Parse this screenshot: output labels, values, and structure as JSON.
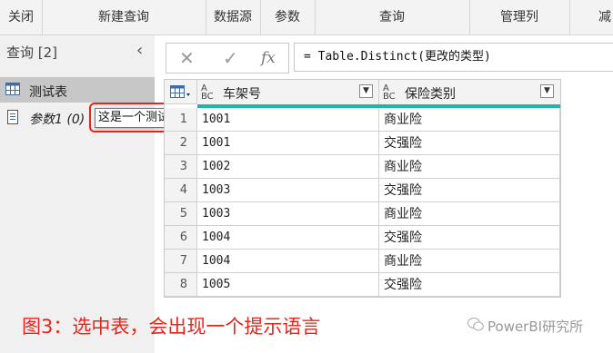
{
  "ribbon": {
    "groups": [
      "关闭",
      "新建查询",
      "数据源",
      "参数",
      "查询",
      "管理列",
      "减"
    ]
  },
  "query_pane": {
    "header": "查询 [2]",
    "collapse_glyph": "‹",
    "items": [
      {
        "label": "测试表",
        "icon": "table-icon",
        "selected": true
      },
      {
        "label": "参数1 (0)",
        "icon": "parameter-icon",
        "selected": false
      }
    ],
    "tooltip": "这是一个测试"
  },
  "formula_bar": {
    "cancel_glyph": "✕",
    "commit_glyph": "✓",
    "fx_glyph": "fx",
    "formula": "= Table.Distinct(更改的类型)"
  },
  "table": {
    "columns": [
      {
        "type_icon": "text-type-icon",
        "type_glyph_top": "A",
        "type_glyph_bottom": "BC",
        "name": "车架号"
      },
      {
        "type_icon": "text-type-icon",
        "type_glyph_top": "A",
        "type_glyph_bottom": "BC",
        "name": "保险类别"
      }
    ],
    "rows": [
      {
        "n": "1",
        "vin": "1001",
        "category": "商业险"
      },
      {
        "n": "2",
        "vin": "1001",
        "category": "交强险"
      },
      {
        "n": "3",
        "vin": "1002",
        "category": "商业险"
      },
      {
        "n": "4",
        "vin": "1003",
        "category": "交强险"
      },
      {
        "n": "5",
        "vin": "1003",
        "category": "商业险"
      },
      {
        "n": "6",
        "vin": "1004",
        "category": "交强险"
      },
      {
        "n": "7",
        "vin": "1004",
        "category": "商业险"
      },
      {
        "n": "8",
        "vin": "1005",
        "category": "交强险"
      }
    ]
  },
  "caption": "图3：选中表，会出现一个提示语言",
  "watermark": "PowerBI研究所",
  "colors": {
    "accent_teal": "#1fb5a8",
    "highlight_red": "#e8251d",
    "selected_bg": "#c7c7c7"
  }
}
